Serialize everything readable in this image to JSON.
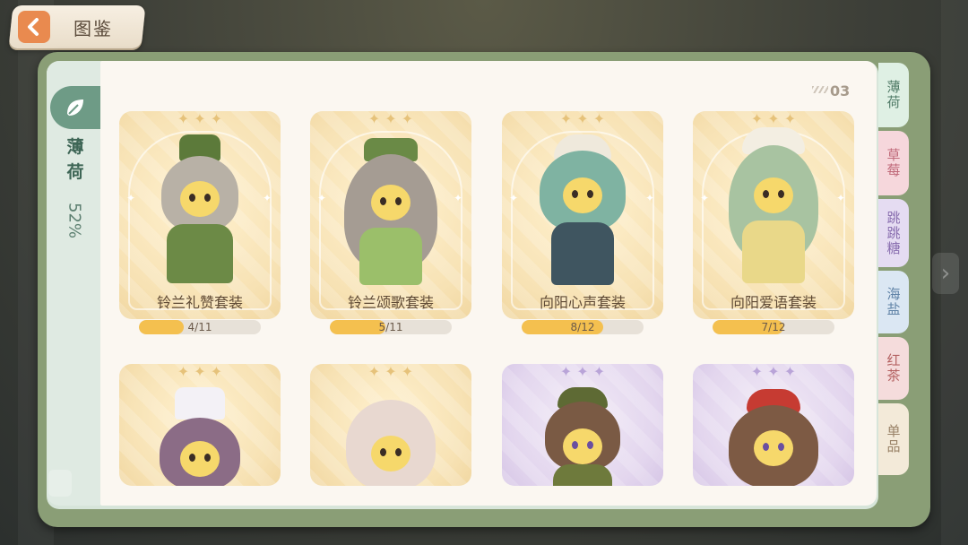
{
  "header": {
    "title": "图鉴"
  },
  "sidebar": {
    "category": "薄荷",
    "percent": "52%"
  },
  "page_number": "03",
  "cards": [
    {
      "name": "铃兰礼赞套装",
      "progress_text": "4/11",
      "progress": 0.364
    },
    {
      "name": "铃兰颂歌套装",
      "progress_text": "5/11",
      "progress": 0.455
    },
    {
      "name": "向阳心声套装",
      "progress_text": "8/12",
      "progress": 0.667
    },
    {
      "name": "向阳爱语套装",
      "progress_text": "7/12",
      "progress": 0.583
    }
  ],
  "right_tabs": [
    {
      "label": "薄荷",
      "color": "#dff0e4",
      "text_color": "#4f7a66"
    },
    {
      "label": "草莓",
      "color": "#f6d7dc",
      "text_color": "#c06a7a"
    },
    {
      "label": "跳跳糖",
      "color": "#e5dcf2",
      "text_color": "#8a6fb0"
    },
    {
      "label": "海盐",
      "color": "#dbe7f3",
      "text_color": "#5f82a6"
    },
    {
      "label": "红茶",
      "color": "#f5dcdc",
      "text_color": "#b46161"
    },
    {
      "label": "单品",
      "color": "#f3ead9",
      "text_color": "#9a8368"
    }
  ],
  "colors": {
    "accent": "#6e9b86",
    "progress_fill": "#f4c04f",
    "back_arrow": "#e98a4f"
  }
}
